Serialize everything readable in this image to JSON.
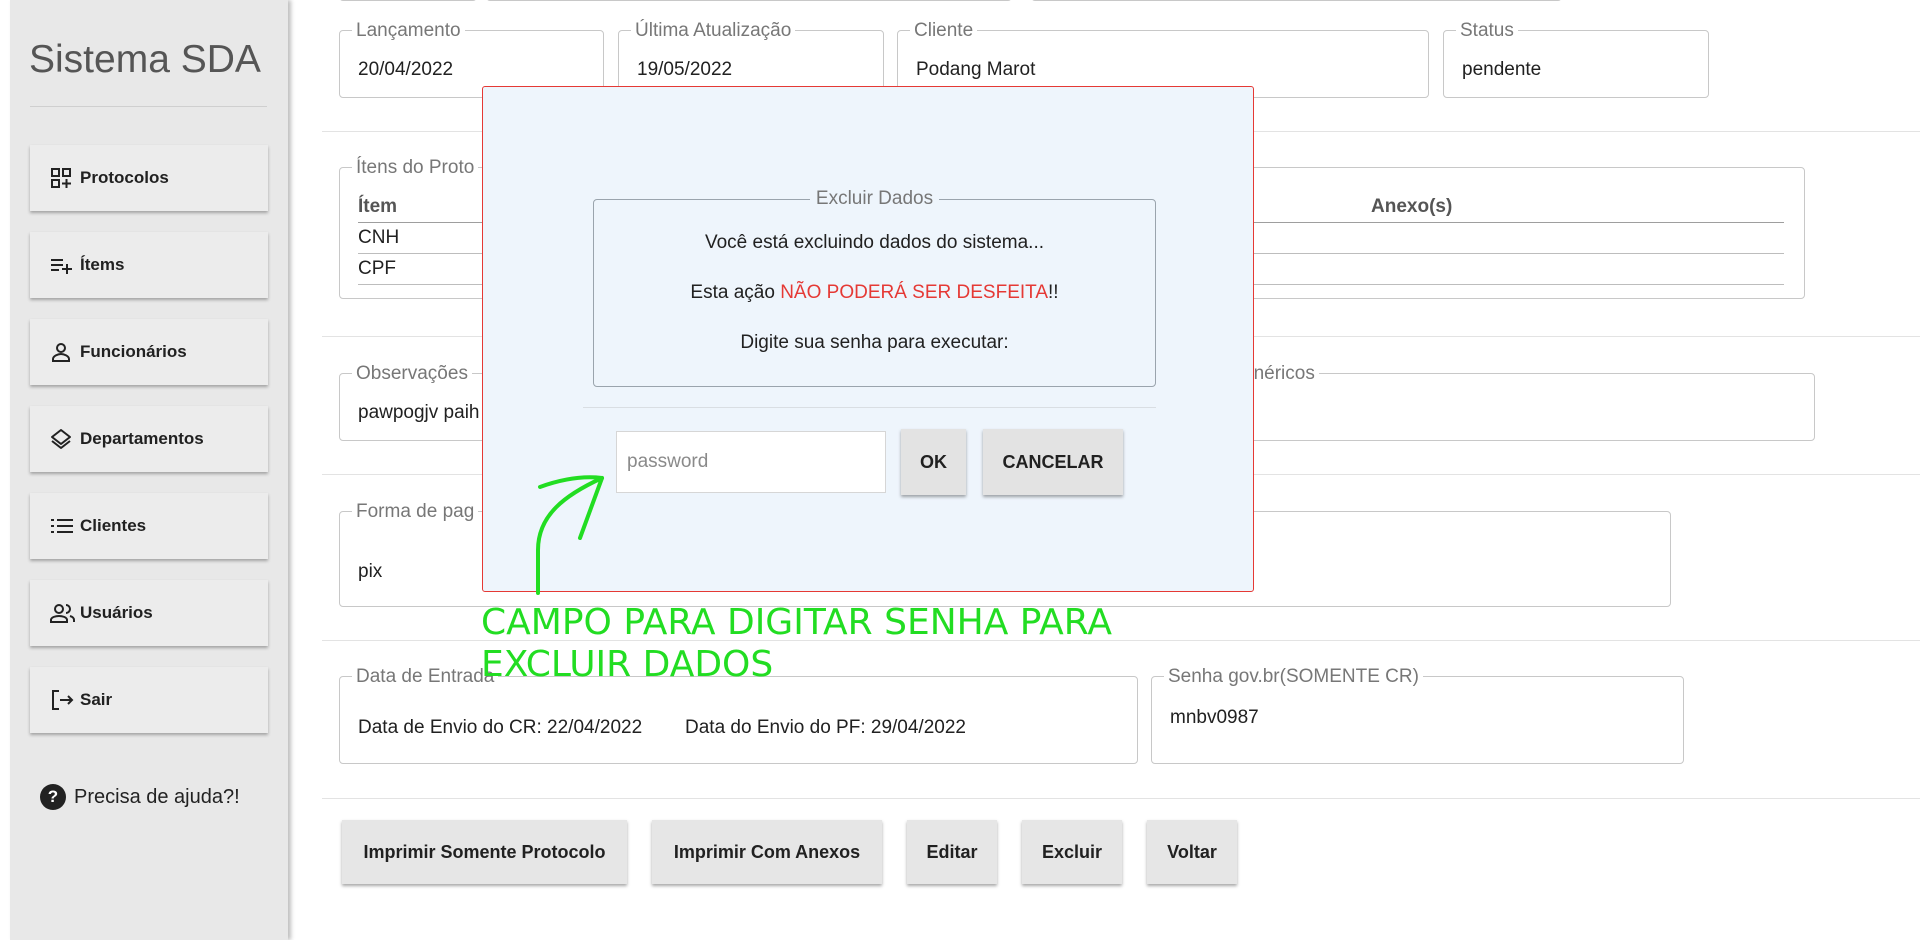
{
  "sidebar": {
    "brand": "Sistema SDA",
    "items": [
      {
        "label": "Protocolos",
        "icon": "grid-add-icon"
      },
      {
        "label": "Ítems",
        "icon": "playlist-add-icon"
      },
      {
        "label": "Funcionários",
        "icon": "person-icon"
      },
      {
        "label": "Departamentos",
        "icon": "layers-icon"
      },
      {
        "label": "Clientes",
        "icon": "list-icon"
      },
      {
        "label": "Usuários",
        "icon": "people-icon"
      },
      {
        "label": "Sair",
        "icon": "logout-icon"
      }
    ],
    "help": "Precisa de ajuda?!"
  },
  "header_fields": {
    "lancamento": {
      "label": "Lançamento",
      "value": "20/04/2022"
    },
    "atualizacao": {
      "label": "Última Atualização",
      "value": "19/05/2022"
    },
    "cliente": {
      "label": "Cliente",
      "value": "Podang Marot"
    },
    "status": {
      "label": "Status",
      "value": "pendente"
    }
  },
  "items_section": {
    "label": "Ítens do Proto",
    "col_item": "Ítem",
    "col_anexos": "Anexo(s)",
    "rows": [
      "CNH",
      "CPF"
    ]
  },
  "observacoes": {
    "label": "Observações",
    "value": "pawpogjv paih"
  },
  "genericos": {
    "label": "enéricos"
  },
  "pagamento": {
    "label": "Forma de pag",
    "value": "pix"
  },
  "entrada": {
    "label": "Data de Entrada",
    "envio_cr_label": "Data de Envio do CR:",
    "envio_cr_value": "22/04/2022",
    "envio_pf_label": "Data do Envio do PF:",
    "envio_pf_value": "29/04/2022"
  },
  "senha_gov": {
    "label": "Senha gov.br(SOMENTE CR)",
    "value": "mnbv0987"
  },
  "buttons": {
    "imprimir_protocolo": "Imprimir Somente Protocolo",
    "imprimir_anexos": "Imprimir Com Anexos",
    "editar": "Editar",
    "excluir": "Excluir",
    "voltar": "Voltar"
  },
  "dialog": {
    "title": "Excluir Dados",
    "line1": "Você está excluindo dados do sistema...",
    "line2_pre": "Esta ação ",
    "line2_warn": "NÃO PODERÁ SER DESFEITA",
    "line2_post": "!!",
    "line3": "Digite sua senha para executar:",
    "password_placeholder": "password",
    "ok": "OK",
    "cancel": "CANCELAR"
  },
  "annotation": {
    "line1": "CAMPO PARA DIGITAR SENHA PARA",
    "line2": "EXCLUIR DADOS",
    "color": "#22dd22"
  },
  "colors": {
    "warning": "#e53935",
    "dialog_bg": "#eef5fc",
    "sidebar_bg": "#e8e8e8"
  }
}
